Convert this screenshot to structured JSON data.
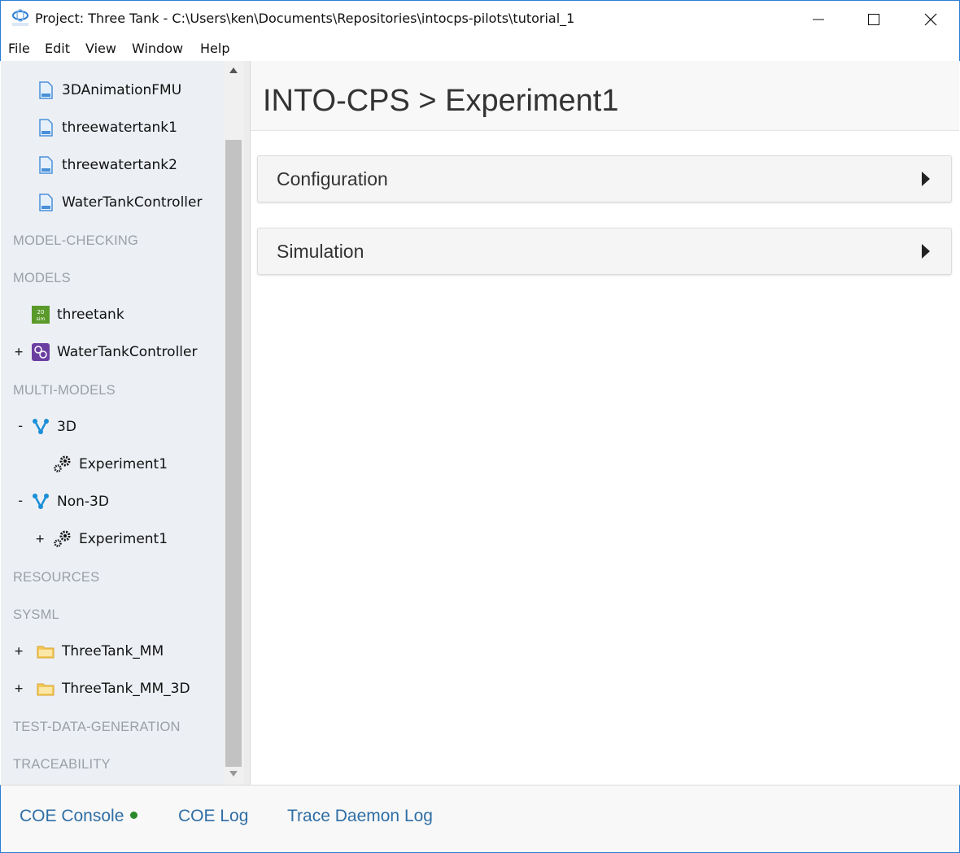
{
  "window": {
    "title": "Project: Three Tank - C:\\Users\\ken\\Documents\\Repositories\\intocps-pilots\\tutorial_1",
    "minimize_icon": "minimize-icon",
    "maximize_icon": "maximize-icon",
    "close_icon": "close-icon"
  },
  "menu": {
    "items": [
      "File",
      "Edit",
      "View",
      "Window",
      "Help"
    ]
  },
  "sidebar": {
    "fmus": [
      {
        "label": "3DAnimationFMU",
        "icon": "file-icon"
      },
      {
        "label": "threewatertank1",
        "icon": "file-icon"
      },
      {
        "label": "threewatertank2",
        "icon": "file-icon"
      },
      {
        "label": "WaterTankController",
        "icon": "file-icon"
      }
    ],
    "sections": {
      "model_checking": "MODEL-CHECKING",
      "models": "MODELS",
      "multi_models": "MULTI-MODELS",
      "resources": "RESOURCES",
      "sysml": "SYSML",
      "test_data_generation": "TEST-DATA-GENERATION",
      "traceability": "TRACEABILITY"
    },
    "models": [
      {
        "label": "threetank",
        "icon": "20sim-icon",
        "toggle": ""
      },
      {
        "label": "WaterTankController",
        "icon": "overture-icon",
        "toggle": "+"
      }
    ],
    "multi_models": [
      {
        "label": "3D",
        "icon": "multimodel-icon",
        "toggle": "-"
      },
      {
        "label": "Experiment1",
        "icon": "gears-icon",
        "toggle": ""
      },
      {
        "label": "Non-3D",
        "icon": "multimodel-icon",
        "toggle": "-"
      },
      {
        "label": "Experiment1",
        "icon": "gears-icon",
        "toggle": "+"
      }
    ],
    "sysml": [
      {
        "label": "ThreeTank_MM",
        "icon": "folder-icon",
        "toggle": "+"
      },
      {
        "label": "ThreeTank_MM_3D",
        "icon": "folder-icon",
        "toggle": "+"
      }
    ]
  },
  "main": {
    "title": "INTO-CPS > Experiment1",
    "panels": [
      {
        "label": "Configuration"
      },
      {
        "label": "Simulation"
      }
    ]
  },
  "bottom": {
    "coe_console": "COE Console",
    "coe_log": "COE Log",
    "trace_daemon_log": "Trace Daemon Log",
    "status_color": "#2a8a2a"
  }
}
